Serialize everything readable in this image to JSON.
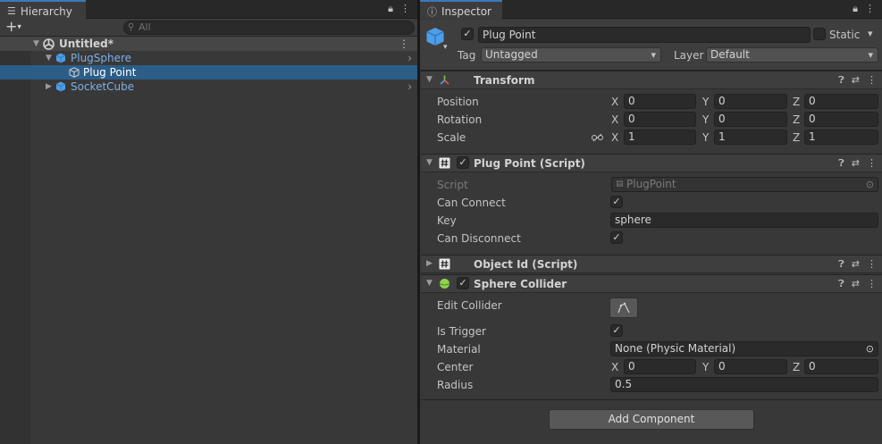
{
  "hierarchy": {
    "tab_label": "Hierarchy",
    "add_label": "+",
    "search_placeholder": "All",
    "scene": {
      "name": "Untitled*"
    },
    "items": [
      {
        "label": "PlugSphere"
      },
      {
        "label": "Plug Point"
      },
      {
        "label": "SocketCube"
      }
    ]
  },
  "inspector": {
    "tab_label": "Inspector",
    "object": {
      "name": "Plug Point",
      "static_label": "Static",
      "tag_label": "Tag",
      "tag_value": "Untagged",
      "layer_label": "Layer",
      "layer_value": "Default"
    },
    "transform": {
      "title": "Transform",
      "position": {
        "label": "Position",
        "x": "0",
        "y": "0",
        "z": "0"
      },
      "rotation": {
        "label": "Rotation",
        "x": "0",
        "y": "0",
        "z": "0"
      },
      "scale": {
        "label": "Scale",
        "x": "1",
        "y": "1",
        "z": "1"
      },
      "axis_x": "X",
      "axis_y": "Y",
      "axis_z": "Z"
    },
    "plug_point": {
      "title": "Plug Point (Script)",
      "script_label": "Script",
      "script_value": "PlugPoint",
      "can_connect_label": "Can Connect",
      "key_label": "Key",
      "key_value": "sphere",
      "can_disconnect_label": "Can Disconnect"
    },
    "object_id": {
      "title": "Object Id (Script)"
    },
    "sphere_collider": {
      "title": "Sphere Collider",
      "edit_collider_label": "Edit Collider",
      "is_trigger_label": "Is Trigger",
      "material_label": "Material",
      "material_value": "None (Physic Material)",
      "center_label": "Center",
      "center": {
        "x": "0",
        "y": "0",
        "z": "0"
      },
      "radius_label": "Radius",
      "radius_value": "0.5"
    },
    "add_component_label": "Add Component"
  },
  "colors": {
    "selection": "#2c5d87",
    "accent_blue": "#3a79bb",
    "prefab_text": "#7bafe8",
    "collider_green": "#8fd14f"
  }
}
